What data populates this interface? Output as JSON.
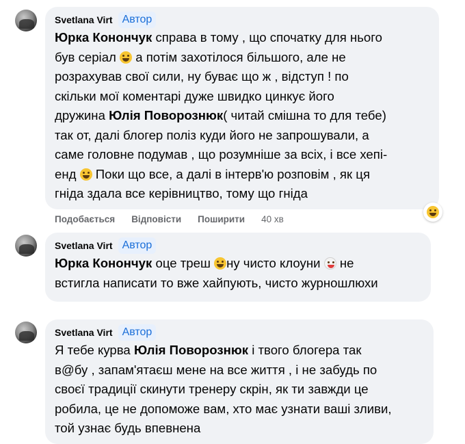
{
  "comments": [
    {
      "author": "Svetlana Virt",
      "badge": "Автор",
      "segments": [
        {
          "bold": true,
          "text": "Юрка Конончук"
        },
        {
          "bold": false,
          "text": " справа в тому , що спочатку для нього"
        },
        {
          "br": true
        },
        {
          "bold": false,
          "text": "був серіал "
        },
        {
          "emoji": "grinning-face-emoji"
        },
        {
          "bold": false,
          "text": " а потім захотілося більшого, але не"
        },
        {
          "br": true
        },
        {
          "bold": false,
          "text": "розрахував свої сили, ну буває що ж , відступ ! по"
        },
        {
          "br": true
        },
        {
          "bold": false,
          "text": "скільки мої коментарі дуже швидко цинкує його"
        },
        {
          "br": true
        },
        {
          "bold": false,
          "text": "дружина "
        },
        {
          "bold": true,
          "text": "Юлія Поворознюк"
        },
        {
          "bold": false,
          "text": "( читай смішна то для тебе)"
        },
        {
          "br": true
        },
        {
          "bold": false,
          "text": "так от, далі блогер поліз куди його не запрошували, а"
        },
        {
          "br": true
        },
        {
          "bold": false,
          "text": "саме головне подумав , що розумніше за всіх, і все хепі-"
        },
        {
          "br": true
        },
        {
          "bold": false,
          "text": "енд "
        },
        {
          "emoji": "laughing-tears-emoji"
        },
        {
          "bold": false,
          "text": " Поки що все, а далі в інтерв'ю розповім , як ця"
        },
        {
          "br": true
        },
        {
          "bold": false,
          "text": "гніда здала все керівництво, тому що гніда"
        }
      ],
      "actions": {
        "like": "Подобається",
        "reply": "Відповісти",
        "share": "Поширити",
        "time": "40 хв"
      },
      "reaction_icon": "laughing-reaction-icon"
    },
    {
      "author": "Svetlana Virt",
      "badge": "Автор",
      "segments": [
        {
          "bold": true,
          "text": "Юрка Конончук"
        },
        {
          "bold": false,
          "text": " оце треш "
        },
        {
          "emoji": "laughing-tears-emoji"
        },
        {
          "bold": false,
          "text": "ну чисто клоуни "
        },
        {
          "emoji": "clown-emoji"
        },
        {
          "bold": false,
          "text": " не"
        },
        {
          "br": true
        },
        {
          "bold": false,
          "text": "встигла написати то вже хайпують, чисто журношлюхи"
        }
      ]
    },
    {
      "author": "Svetlana Virt",
      "badge": "Автор",
      "segments": [
        {
          "bold": false,
          "text": "Я тебе курва "
        },
        {
          "bold": true,
          "text": "Юлія Поворознюк"
        },
        {
          "bold": false,
          "text": " і твого блогера так"
        },
        {
          "br": true
        },
        {
          "bold": false,
          "text": "в@бу , запам'ятаєш мене на все життя , і не забудь по"
        },
        {
          "br": true
        },
        {
          "bold": false,
          "text": "своєї традиції скинути тренеру скрін, як ти завжди це"
        },
        {
          "br": true
        },
        {
          "bold": false,
          "text": "робила, це не допоможе вам, хто має узнати ваші зливи,"
        },
        {
          "br": true
        },
        {
          "bold": false,
          "text": "той узнає будь впевнена"
        }
      ]
    }
  ]
}
